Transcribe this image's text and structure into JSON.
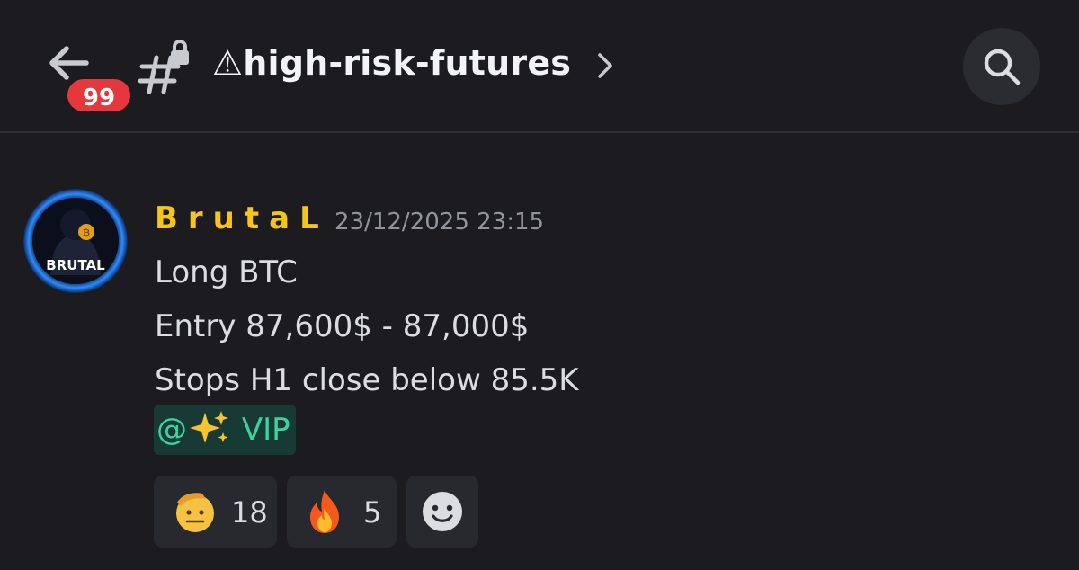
{
  "header": {
    "unread_count": "99",
    "channel_name": "⚠high-risk-futures"
  },
  "message": {
    "author": "BrutaL",
    "timestamp": "23/12/2025 23:15",
    "avatar_text": "BRUTAL",
    "lines": [
      "Long BTC",
      "Entry 87,600$ - 87,000$",
      "Stops H1 close below 85.5K"
    ],
    "mention": {
      "prefix": "@",
      "role": "VIP"
    },
    "reactions": [
      {
        "emoji": "saluting-face",
        "count": "18"
      },
      {
        "emoji": "fire",
        "count": "5"
      }
    ]
  },
  "colors": {
    "background": "#1b1b20",
    "author": "#f5c518",
    "mention_text": "#3dd39f",
    "mention_bg": "#183a34",
    "badge": "#e5383d"
  }
}
